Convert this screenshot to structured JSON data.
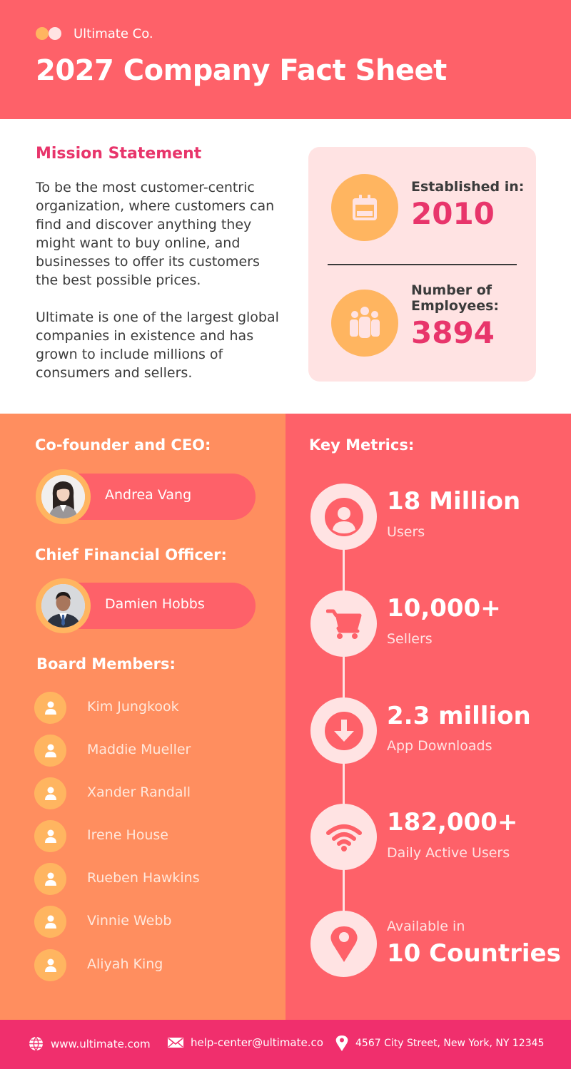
{
  "header": {
    "brand": "Ultimate Co.",
    "title": "2027 Company Fact Sheet"
  },
  "mission": {
    "heading": "Mission Statement",
    "paragraph1": "To be the most customer-centric organization, where customers can find and discover anything they might want to buy online, and businesses to offer its customers the best possible prices.",
    "paragraph2": "Ultimate is one of the largest global companies in existence and has grown to include millions of consumers and sellers."
  },
  "facts": {
    "established_label": "Established in:",
    "established_value": "2010",
    "employees_label": "Number of Employees:",
    "employees_value": "3894",
    "icons": [
      "calendar-icon",
      "employees-icon"
    ]
  },
  "leadership": {
    "ceo_heading": "Co-founder and CEO:",
    "ceo_name": "Andrea Vang",
    "cfo_heading": "Chief Financial Officer:",
    "cfo_name": "Damien Hobbs",
    "board_heading": "Board Members:",
    "board_members": [
      "Kim Jungkook",
      "Maddie Mueller",
      "Xander Randall",
      "Irene House",
      "Rueben Hawkins",
      "Vinnie Webb",
      "Aliyah King"
    ]
  },
  "metrics": {
    "heading": "Key Metrics:",
    "items": [
      {
        "value": "18 Million",
        "label": "Users",
        "icon": "user-icon"
      },
      {
        "value": "10,000+",
        "label": "Sellers",
        "icon": "cart-icon"
      },
      {
        "value": "2.3 million",
        "label": "App Downloads",
        "icon": "download-icon"
      },
      {
        "value": "182,000+",
        "label": "Daily Active Users",
        "icon": "wifi-icon"
      },
      {
        "label": "Available in",
        "value": "10 Countries",
        "icon": "location-pin-icon"
      }
    ]
  },
  "footer": {
    "website": "www.ultimate.com",
    "email": "help-center@ultimate.co",
    "address": "4567 City Street, New York, NY 12345"
  },
  "colors": {
    "coral": "#fe6169",
    "orange": "#ff8e5f",
    "gold": "#ffb560",
    "blush": "#ffe3e3",
    "magenta": "#e8356b",
    "footer": "#f02f6d"
  }
}
